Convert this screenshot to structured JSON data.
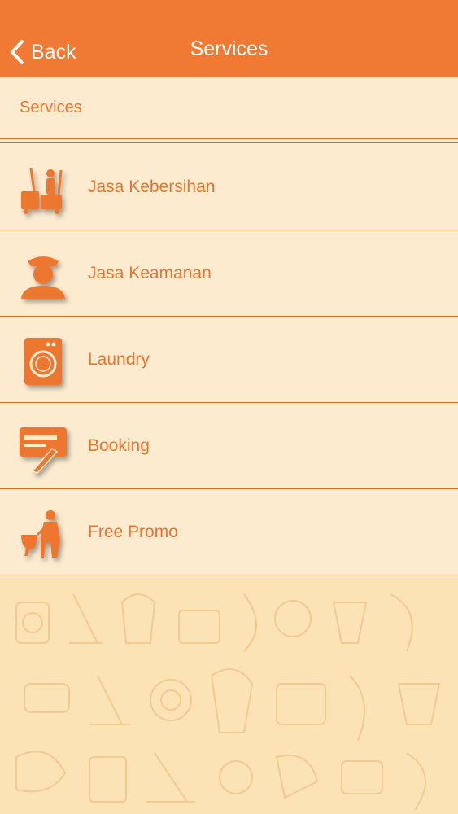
{
  "nav": {
    "back_label": "Back",
    "title": "Services"
  },
  "section": {
    "header": "Services"
  },
  "items": [
    {
      "label": "Jasa Kebersihan",
      "icon": "cleaning-cart-icon"
    },
    {
      "label": "Jasa Keamanan",
      "icon": "security-guard-icon"
    },
    {
      "label": "Laundry",
      "icon": "washing-machine-icon"
    },
    {
      "label": "Booking",
      "icon": "booking-card-icon"
    },
    {
      "label": "Free Promo",
      "icon": "plumber-toilet-icon"
    }
  ],
  "colors": {
    "accent": "#f07a33",
    "background": "#fdebd0",
    "text": "#e8742f",
    "divider": "#d86a20",
    "pattern_bg": "#fbe3b6"
  }
}
